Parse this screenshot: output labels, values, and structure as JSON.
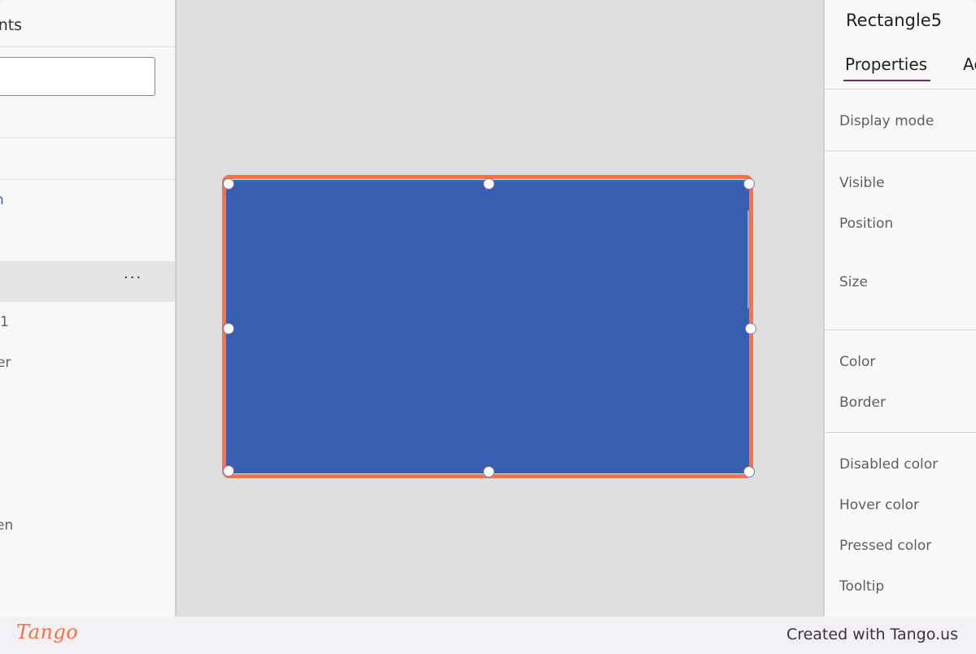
{
  "left_panel": {
    "title": "ents",
    "search": {
      "value": "",
      "placeholder": ""
    },
    "items": [
      {
        "label": "n",
        "state": "link"
      },
      {
        "label": "",
        "state": "selected",
        "more_label": "···"
      },
      {
        "label": "1",
        "state": "normal"
      },
      {
        "label": "er",
        "state": "normal"
      },
      {
        "label": "en",
        "state": "normal"
      }
    ]
  },
  "canvas": {
    "selected_shape": {
      "name": "Rectangle5",
      "fill_color": "#365fb1",
      "selection_color": "#ff7240"
    }
  },
  "right_panel": {
    "title": "Rectangle5",
    "tabs": [
      {
        "label": "Properties",
        "active": true
      },
      {
        "label": "Ad",
        "active": false
      }
    ],
    "properties": [
      "Display mode",
      "Visible",
      "Position",
      "Size",
      "Color",
      "Border",
      "Disabled color",
      "Hover color",
      "Pressed color",
      "Tooltip"
    ]
  },
  "footer": {
    "logo": "Tango",
    "credit": "Created with Tango.us"
  }
}
